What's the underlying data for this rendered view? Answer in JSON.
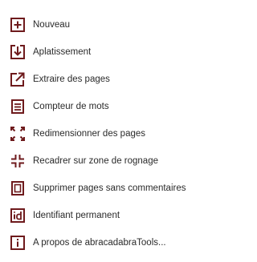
{
  "theme": {
    "icon_color": "#6e1a1c",
    "text_color": "#2a2a2a",
    "background": "#ffffff"
  },
  "menu": {
    "items": [
      {
        "label": "Nouveau",
        "icon": "plus-square-icon"
      },
      {
        "label": "Aplatissement",
        "icon": "flatten-download-icon"
      },
      {
        "label": "Extraire des pages",
        "icon": "external-link-icon"
      },
      {
        "label": "Compteur de mots",
        "icon": "word-count-icon"
      },
      {
        "label": "Redimensionner des pages",
        "icon": "expand-icon"
      },
      {
        "label": "Recadrer sur zone de rognage",
        "icon": "crop-collapse-icon"
      },
      {
        "label": "Supprimer pages sans commentaires",
        "icon": "delete-page-icon"
      },
      {
        "label": "Identifiant permanent",
        "icon": "id-badge-icon"
      },
      {
        "label": "A propos de abracadabraTools...",
        "icon": "info-icon"
      }
    ]
  }
}
